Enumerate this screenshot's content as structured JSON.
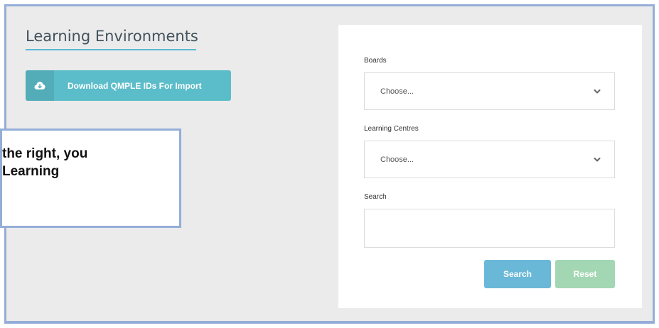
{
  "page": {
    "title": "Learning Environments",
    "download_button_label": "Download QMPLE IDs For Import",
    "download_icon": "cloud-download-icon"
  },
  "callout": {
    "text": "the right, you\nLearning"
  },
  "filters": {
    "boards": {
      "label": "Boards",
      "value": "Choose..."
    },
    "learning_centres": {
      "label": "Learning Centres",
      "value": "Choose..."
    },
    "search": {
      "label": "Search",
      "value": "",
      "placeholder": ""
    },
    "search_button_label": "Search",
    "reset_button_label": "Reset",
    "chevron_icon": "chevron-down-icon"
  },
  "colors": {
    "frame_border": "#95aed8",
    "background": "#ebebeb",
    "download_button": "#5bbdc9",
    "search_button": "#6ab8d8",
    "reset_button": "#a3d7b4",
    "title_underline": "#5bb8d2"
  }
}
